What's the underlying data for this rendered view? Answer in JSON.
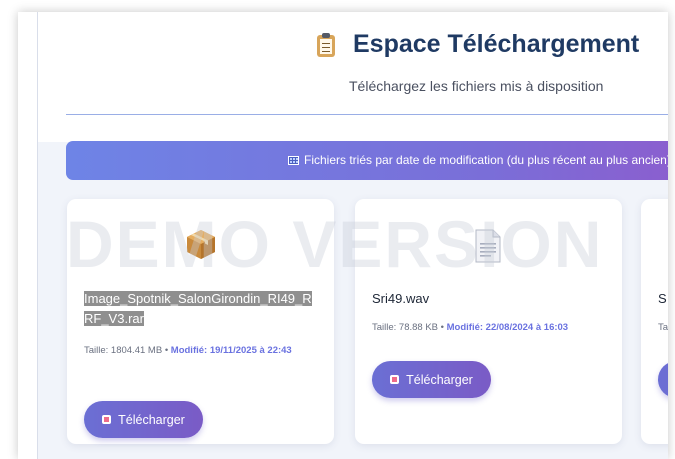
{
  "header": {
    "title": "Espace Téléchargement",
    "subtitle": "Téléchargez les fichiers mis à disposition"
  },
  "banner": {
    "text": "Fichiers triés par date de modification (du plus récent au plus ancien)"
  },
  "watermark": "DEMO VERSION",
  "files": [
    {
      "name": "Image_Spotnik_SalonGirondin_RI49_RRF_V3.rar",
      "size_label": "Taille: 1804.41 MB",
      "modified_label": "Modifié: 19/11/2025 à 22:43",
      "icon": "package-icon"
    },
    {
      "name": "Sri49.wav",
      "size_label": "Taille: 78.88 KB",
      "modified_label": "Modifié: 22/08/2024 à 16:03",
      "icon": "document-icon"
    },
    {
      "name": "S",
      "size_label": "Ta",
      "modified_label": ""
    }
  ],
  "buttons": {
    "download_label": "Télécharger"
  },
  "separator": "•",
  "colors": {
    "title": "#1f3a63",
    "banner_start": "#6e84e6",
    "banner_end": "#8a5fcf",
    "button": "#7065d0",
    "modified_text": "#6a72e0"
  }
}
